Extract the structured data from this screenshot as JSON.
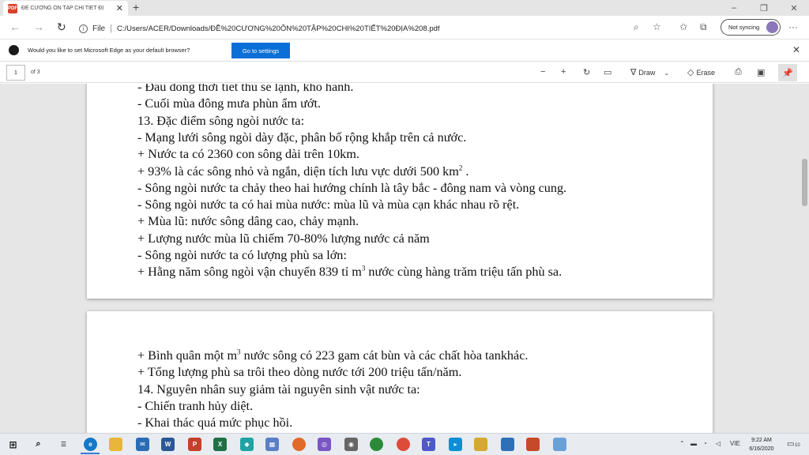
{
  "browser": {
    "tab_title": "ĐỀ CƯƠNG ÔN TẬP CHI TIẾT ĐỊ",
    "tab_icon": "pdf-icon",
    "new_tab": "+",
    "window_controls": [
      "–",
      "❐",
      "✕"
    ],
    "nav": {
      "back": "←",
      "forward": "→",
      "refresh": "↻"
    },
    "address": {
      "protocol_label": "File",
      "url": "C:/Users/ACER/Downloads/ĐỀ%20CƯƠNG%20ÔN%20TẬP%20CHI%20TIẾT%20ĐỊA%208.pdf"
    },
    "sync_label": "Not syncing",
    "more": "···"
  },
  "infobar": {
    "message": "Would you like to set Microsoft Edge as your default browser?",
    "button": "Go to settings",
    "close": "✕"
  },
  "pdf_toolbar": {
    "page_number": "1",
    "page_of": "of 3",
    "draw_label": "Draw",
    "erase_label": "Erase"
  },
  "page1_lines": [
    "- Đầu đông thời tiết thủ sẽ lạnh, khô hanh.",
    "- Cuối mùa đông mưa phùn ẩm ướt.",
    "13. Đặc điểm sông ngòi nước ta:",
    "- Mạng lưới sông ngòi dày đặc, phân bố rộng khắp trên cả nước.",
    "+ Nước ta có 2360 con sông dài trên 10km.",
    "+ 93% là các sông nhỏ và ngắn, diện tích lưu vực dưới 500 km",
    "- Sông ngòi nước ta chảy theo hai hướng chính là tây bắc - đông nam và vòng cung.",
    "- Sông ngòi nước ta có hai mùa nước: mùa lũ và mùa cạn khác nhau rõ rệt.",
    "+ Mùa lũ: nước sông dâng cao, chảy mạnh.",
    "+ Lượng nước mùa lũ chiếm 70-80% lượng nước cả năm",
    "- Sông ngòi nước ta có lượng phù sa lớn:",
    "+ Hằng năm sông ngòi vận chuyển 839 tỉ m",
    "nước cùng hàng trăm triệu tấn phù sa."
  ],
  "page1_sup": [
    "2",
    " .",
    "3"
  ],
  "page2_lines": [
    "+ Bình quân một m",
    "nước sông có 223 gam cát bùn và các chất hòa tankhác.",
    "+ Tổng lượng phù sa trôi theo dòng nước tới 200 triệu tấn/năm.",
    "14. Nguyên nhân suy giảm tài nguyên sinh vật nước ta:",
    "- Chiến tranh hủy diệt.",
    "- Khai thác quá mức phục hồi."
  ],
  "page2_sup": [
    "3"
  ],
  "taskbar": {
    "lang": "VIE",
    "time": "9:22 AM",
    "date": "6/16/2020",
    "notif_count": "10"
  },
  "colors": {
    "accent": "#0a6fd6",
    "pdf_red": "#d9412b"
  }
}
